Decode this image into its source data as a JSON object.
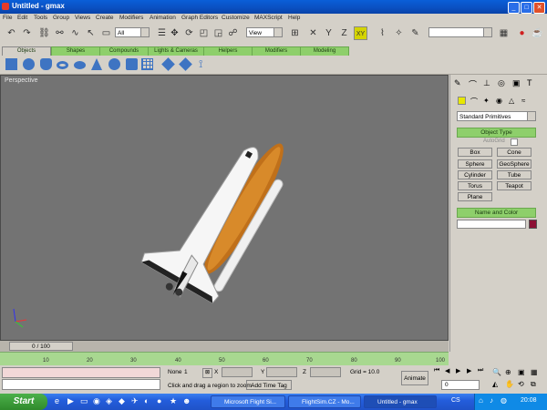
{
  "window": {
    "title": "Untitled - gmax",
    "min": "_",
    "max": "□",
    "close": "✕"
  },
  "menu": [
    "File",
    "Edit",
    "Tools",
    "Group",
    "Views",
    "Create",
    "Modifiers",
    "Animation",
    "Graph Editors",
    "Customize",
    "MAXScript",
    "Help"
  ],
  "toolbar": {
    "selection_filter": "All",
    "ref_coord": "View",
    "axis_constraint": "XY"
  },
  "tabs": [
    "Objects",
    "Shapes",
    "Compounds",
    "Lights & Cameras",
    "Helpers",
    "Modifiers",
    "Modeling"
  ],
  "viewport": {
    "label": "Perspective"
  },
  "timeline": {
    "frame": "0 / 100",
    "ticks": [
      "10",
      "20",
      "30",
      "40",
      "50",
      "60",
      "70",
      "80",
      "90",
      "100"
    ]
  },
  "command_panel": {
    "category": "Standard Primitives",
    "object_type_title": "Object Type",
    "autogrid": "AutoGrid",
    "objects": [
      "Box",
      "Cone",
      "Sphere",
      "GeoSphere",
      "Cylinder",
      "Tube",
      "Torus",
      "Teapot",
      "Plane"
    ],
    "name_color_title": "Name and Color",
    "color_swatch": "#8c1034"
  },
  "status": {
    "selection": "None",
    "lock": "1",
    "x_label": "X",
    "y_label": "Y",
    "z_label": "Z",
    "grid": "Grid = 10.0",
    "prompt": "Click and drag a region to zoom",
    "add_time_tag": "Add Time Tag",
    "animate": "Animate",
    "frame_value": "0"
  },
  "taskbar": {
    "start": "Start",
    "tasks": [
      "Microsoft Flight Si...",
      "FlightSim.CZ - Mo...",
      "Untitled - gmax"
    ],
    "lang": "CS",
    "clock": "20:08"
  },
  "colors": {
    "accent_green": "#8ecf6b",
    "viewport_bg": "#737373",
    "title_blue": "#0a4fc0"
  }
}
